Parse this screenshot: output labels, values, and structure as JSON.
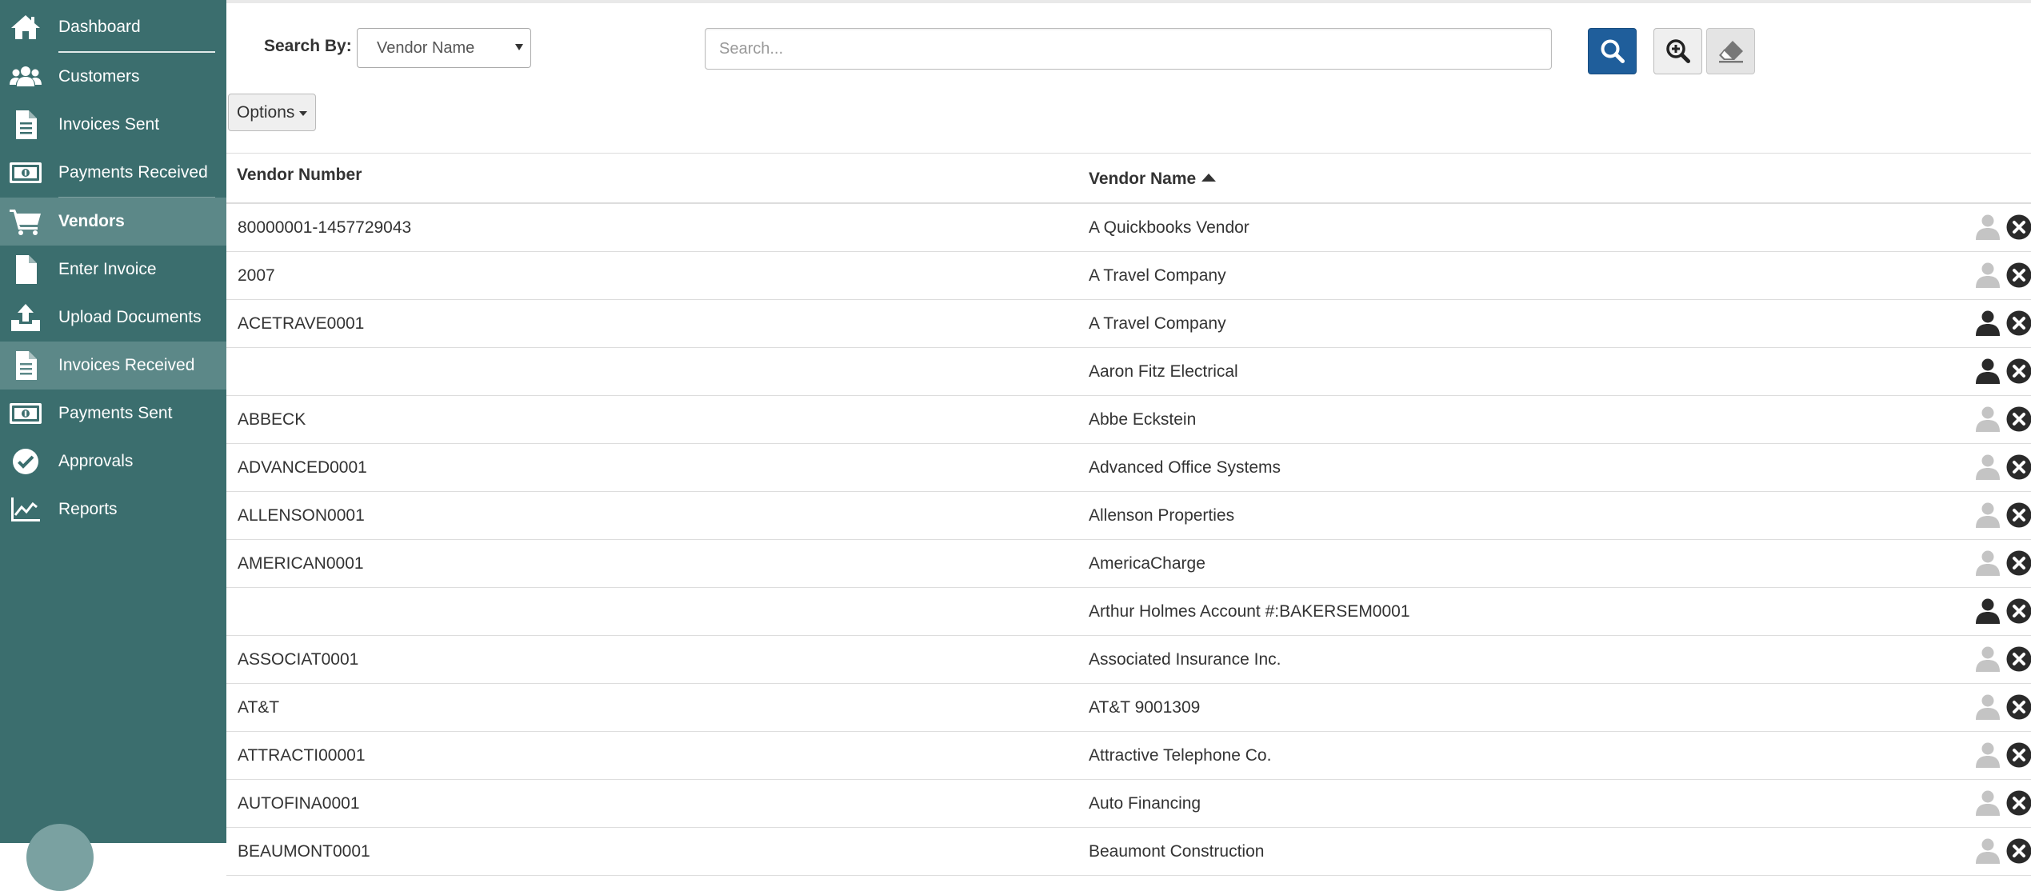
{
  "sidebar": {
    "items": [
      {
        "label": "Dashboard",
        "icon": "home-icon"
      },
      {
        "label": "Customers",
        "icon": "users-icon"
      },
      {
        "label": "Invoices Sent",
        "icon": "document-icon"
      },
      {
        "label": "Payments Received",
        "icon": "money-icon"
      },
      {
        "label": "Vendors",
        "icon": "cart-icon"
      },
      {
        "label": "Enter Invoice",
        "icon": "file-icon"
      },
      {
        "label": "Upload Documents",
        "icon": "upload-icon"
      },
      {
        "label": "Invoices Received",
        "icon": "document-icon"
      },
      {
        "label": "Payments Sent",
        "icon": "money-icon"
      },
      {
        "label": "Approvals",
        "icon": "check-circle-icon"
      },
      {
        "label": "Reports",
        "icon": "line-chart-icon"
      }
    ],
    "active_item": "Vendors",
    "highlighted_item": "Invoices Received"
  },
  "toolbar": {
    "search_by_label": "Search By:",
    "search_by_value": "Vendor Name",
    "search_placeholder": "Search...",
    "search_value": "",
    "search_button_icon": "search-icon",
    "zoom_button_icon": "zoom-in-icon",
    "clear_button_icon": "eraser-icon",
    "options_label": "Options"
  },
  "table": {
    "columns": [
      "Vendor Number",
      "Vendor Name"
    ],
    "sort": {
      "column": "Vendor Name",
      "direction": "ascending"
    },
    "rows": [
      {
        "vendor_number": "80000001-1457729043",
        "vendor_name": "A Quickbooks Vendor",
        "user_linked": false
      },
      {
        "vendor_number": "2007",
        "vendor_name": "A Travel Company",
        "user_linked": false
      },
      {
        "vendor_number": "ACETRAVE0001",
        "vendor_name": "A Travel Company",
        "user_linked": true
      },
      {
        "vendor_number": "",
        "vendor_name": "Aaron Fitz Electrical",
        "user_linked": true
      },
      {
        "vendor_number": "ABBECK",
        "vendor_name": "Abbe Eckstein",
        "user_linked": false
      },
      {
        "vendor_number": "ADVANCED0001",
        "vendor_name": "Advanced Office Systems",
        "user_linked": false
      },
      {
        "vendor_number": "ALLENSON0001",
        "vendor_name": "Allenson Properties",
        "user_linked": false
      },
      {
        "vendor_number": "AMERICAN0001",
        "vendor_name": "AmericaCharge",
        "user_linked": false
      },
      {
        "vendor_number": "",
        "vendor_name": "Arthur Holmes Account #:BAKERSEM0001",
        "user_linked": true
      },
      {
        "vendor_number": "ASSOCIAT0001",
        "vendor_name": "Associated Insurance Inc.",
        "user_linked": false
      },
      {
        "vendor_number": "AT&T",
        "vendor_name": "AT&T 9001309",
        "user_linked": false
      },
      {
        "vendor_number": "ATTRACTI00001",
        "vendor_name": "Attractive Telephone Co.",
        "user_linked": false
      },
      {
        "vendor_number": "AUTOFINA0001",
        "vendor_name": "Auto Financing",
        "user_linked": false
      },
      {
        "vendor_number": "BEAUMONT0001",
        "vendor_name": "Beaumont Construction",
        "user_linked": false
      }
    ]
  },
  "colors": {
    "sidebar_bg": "#3b6e6e",
    "sidebar_active_bg": "#5c8888",
    "primary_button": "#1f5e9b",
    "user_icon_active": "#2a2a2a",
    "user_icon_inactive": "#c4c4c4",
    "remove_icon": "#2a2a2a"
  }
}
